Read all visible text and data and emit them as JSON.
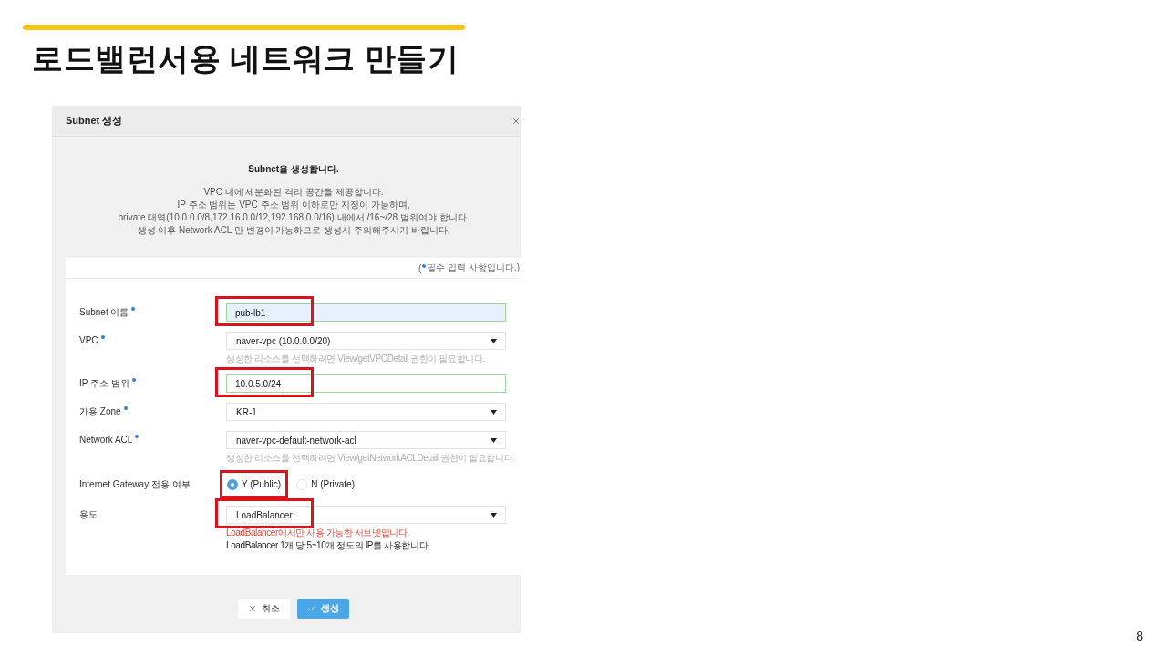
{
  "slide": {
    "title": "로드밸런서용 네트워크 만들기",
    "page_number": "8"
  },
  "dialog": {
    "title": "Subnet 생성",
    "intro": {
      "heading": "Subnet을 생성합니다.",
      "lines": [
        "VPC 내에 세분화된 격리 공간을 제공합니다.",
        "IP 주소 범위는 VPC 주소 범위 이하로만 지정이 가능하며,",
        "private 대역(10.0.0.0/8,172.16.0.0/12,192.168.0.0/16) 내에서 /16~/28 범위여야 합니다.",
        "생성 이후 Network ACL 만 변경이 가능하므로 생성시 주의해주시기 바랍니다."
      ]
    },
    "required_note": {
      "prefix": "(",
      "text": "필수 입력 사항입니다.)"
    },
    "fields": [
      {
        "kind": "input",
        "label": "Subnet 이름",
        "required": true,
        "value": "pub-lb1",
        "autofilled": true,
        "valid": true,
        "highlighted": true
      },
      {
        "kind": "select",
        "label": "VPC",
        "required": true,
        "value": "naver-vpc (10.0.0.0/20)",
        "highlighted": false,
        "notes": [
          {
            "kind": "hint",
            "text": "생성한 리소스를 선택하려면 View/getVPCDetail 권한이 필요합니다."
          }
        ]
      },
      {
        "kind": "input",
        "label": "IP 주소 범위",
        "required": true,
        "value": "10.0.5.0/24",
        "autofilled": false,
        "valid": true,
        "highlighted": true
      },
      {
        "kind": "select",
        "label": "가용 Zone",
        "required": true,
        "value": "KR-1",
        "highlighted": false
      },
      {
        "kind": "select",
        "label": "Network ACL",
        "required": true,
        "value": "naver-vpc-default-network-acl",
        "highlighted": false,
        "notes": [
          {
            "kind": "hint",
            "text": "생성한 리소스를 선택하려면 View/getNetworkACLDetail 권한이 필요합니다."
          }
        ]
      },
      {
        "kind": "radio",
        "label": "Internet Gateway 전용 여부",
        "required": false,
        "options": [
          {
            "label": "Y (Public)",
            "selected": true,
            "highlighted": true
          },
          {
            "label": "N (Private)",
            "selected": false,
            "highlighted": false
          }
        ]
      },
      {
        "kind": "select",
        "label": "용도",
        "required": false,
        "value": "LoadBalancer",
        "highlighted": true,
        "notes": [
          {
            "kind": "warning",
            "text": "LoadBalancer에서만 사용 가능한 서브넷입니다."
          },
          {
            "kind": "info",
            "text": "LoadBalancer 1개 당 5~10개 정도의 IP를 사용합니다."
          }
        ]
      }
    ],
    "buttons": [
      {
        "kind": "cancel",
        "label": "취소"
      },
      {
        "kind": "confirm",
        "label": "생성"
      }
    ]
  }
}
